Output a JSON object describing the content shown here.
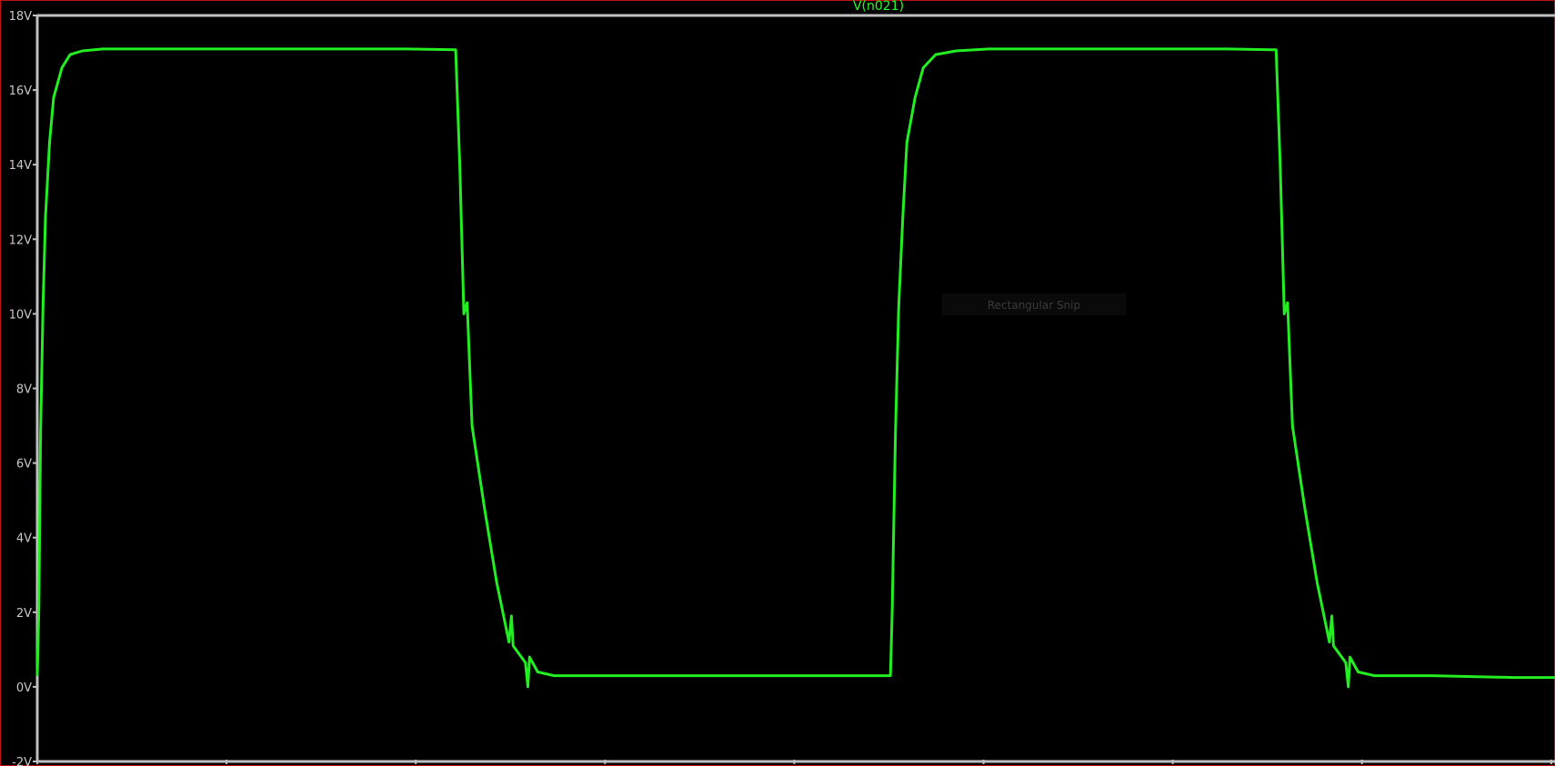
{
  "chart_data": {
    "type": "line",
    "title": "V(n021)",
    "xlabel": "",
    "ylabel": "",
    "ylim": [
      -2,
      18
    ],
    "y_ticks": [
      -2,
      0,
      2,
      4,
      6,
      8,
      10,
      12,
      14,
      16,
      18
    ],
    "y_tick_labels": [
      "-2V",
      "0V",
      "2V",
      "4V",
      "6V",
      "8V",
      "10V",
      "12V",
      "14V",
      "16V",
      "18V"
    ],
    "x_tick_count": 9,
    "grid": false,
    "background": "#000000",
    "series": [
      {
        "name": "V(n021)",
        "color": "#22ee22",
        "points": [
          [
            0.0,
            0.3
          ],
          [
            0.02,
            2.2
          ],
          [
            0.04,
            6.8
          ],
          [
            0.07,
            10.2
          ],
          [
            0.1,
            12.6
          ],
          [
            0.15,
            14.6
          ],
          [
            0.2,
            15.8
          ],
          [
            0.3,
            16.6
          ],
          [
            0.4,
            16.95
          ],
          [
            0.55,
            17.05
          ],
          [
            0.8,
            17.1
          ],
          [
            1.5,
            17.1
          ],
          [
            2.5,
            17.1
          ],
          [
            3.5,
            17.1
          ],
          [
            4.5,
            17.1
          ],
          [
            5.1,
            17.08
          ],
          [
            5.15,
            14.0
          ],
          [
            5.2,
            10.0
          ],
          [
            5.24,
            10.3
          ],
          [
            5.3,
            7.0
          ],
          [
            5.45,
            4.8
          ],
          [
            5.6,
            2.8
          ],
          [
            5.75,
            1.2
          ],
          [
            5.78,
            1.9
          ],
          [
            5.8,
            1.1
          ],
          [
            5.95,
            0.65
          ],
          [
            5.98,
            0.0
          ],
          [
            6.0,
            0.8
          ],
          [
            6.1,
            0.4
          ],
          [
            6.3,
            0.3
          ],
          [
            7.0,
            0.3
          ],
          [
            8.0,
            0.3
          ],
          [
            9.0,
            0.3
          ],
          [
            10.0,
            0.3
          ],
          [
            10.4,
            0.3
          ],
          [
            10.42,
            2.0
          ],
          [
            10.46,
            6.8
          ],
          [
            10.5,
            10.2
          ],
          [
            10.55,
            12.6
          ],
          [
            10.6,
            14.6
          ],
          [
            10.7,
            15.8
          ],
          [
            10.8,
            16.6
          ],
          [
            10.95,
            16.95
          ],
          [
            11.2,
            17.05
          ],
          [
            11.6,
            17.1
          ],
          [
            13.0,
            17.1
          ],
          [
            14.5,
            17.1
          ],
          [
            15.1,
            17.08
          ],
          [
            15.15,
            14.0
          ],
          [
            15.2,
            10.0
          ],
          [
            15.24,
            10.3
          ],
          [
            15.3,
            7.0
          ],
          [
            15.45,
            4.8
          ],
          [
            15.6,
            2.8
          ],
          [
            15.75,
            1.2
          ],
          [
            15.78,
            1.9
          ],
          [
            15.8,
            1.1
          ],
          [
            15.95,
            0.65
          ],
          [
            15.98,
            0.0
          ],
          [
            16.0,
            0.8
          ],
          [
            16.1,
            0.4
          ],
          [
            16.3,
            0.3
          ],
          [
            17.0,
            0.3
          ],
          [
            18.0,
            0.25
          ],
          [
            18.5,
            0.25
          ]
        ]
      }
    ],
    "xlim": [
      0,
      18.5
    ]
  },
  "overlay": {
    "toast_text": "Rectangular Snip"
  }
}
